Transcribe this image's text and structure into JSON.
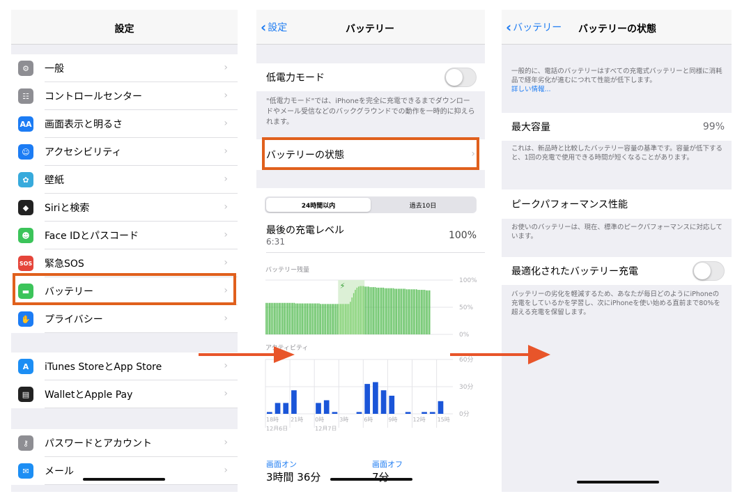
{
  "settings": {
    "title": "設定",
    "group1": [
      {
        "label": "一般",
        "icon": "gear-icon",
        "color": "#8e8e93"
      },
      {
        "label": "コントロールセンター",
        "icon": "toggles-icon",
        "color": "#8e8e93"
      },
      {
        "label": "画面表示と明るさ",
        "icon": "text-size-icon",
        "color": "#1c7cf4",
        "glyph": "AA"
      },
      {
        "label": "アクセシビリティ",
        "icon": "accessibility-icon",
        "color": "#1c7cf4"
      },
      {
        "label": "壁紙",
        "icon": "flower-icon",
        "color": "#37aadc"
      },
      {
        "label": "Siriと検索",
        "icon": "siri-icon",
        "color": "#222222"
      },
      {
        "label": "Face IDとパスコード",
        "icon": "face-id-icon",
        "color": "#3cc45a"
      },
      {
        "label": "緊急SOS",
        "icon": "sos-icon",
        "color": "#e5453a",
        "glyph": "SOS"
      },
      {
        "label": "バッテリー",
        "icon": "battery-icon",
        "color": "#3cc45a"
      },
      {
        "label": "プライバシー",
        "icon": "hand-icon",
        "color": "#1c7cf4"
      }
    ],
    "group2": [
      {
        "label": "iTunes StoreとApp Store",
        "icon": "app-store-icon",
        "color": "#1c8ef4"
      },
      {
        "label": "WalletとApple Pay",
        "icon": "wallet-icon",
        "color": "#222222"
      }
    ],
    "group3": [
      {
        "label": "パスワードとアカウント",
        "icon": "key-icon",
        "color": "#8e8e93"
      },
      {
        "label": "メール",
        "icon": "mail-icon",
        "color": "#1c8ef4"
      }
    ]
  },
  "battery": {
    "back_label": "設定",
    "title": "バッテリー",
    "low_power_label": "低電力モード",
    "low_power_desc": "\"低電力モード\"では、iPhoneを完全に充電できるまでダウンロードやメール受信などのバックグラウンドでの動作を一時的に抑えられます。",
    "health_row_label": "バッテリーの状態",
    "tab_24h": "24時間以内",
    "tab_10d": "過去10日",
    "last_charge_label": "最後の充電レベル",
    "last_charge_time": "6:31",
    "last_charge_value": "100%",
    "level_chart_title": "バッテリー残量",
    "activity_chart_title": "アクティビティ",
    "screen_on_label": "画面オン",
    "screen_on_value": "3時間 36分",
    "screen_off_label": "画面オフ",
    "screen_off_value": "7分"
  },
  "health": {
    "back_label": "バッテリー",
    "title": "バッテリーの状態",
    "intro": "一般的に、電話のバッテリーはすべての充電式バッテリーと同様に消耗品で経年劣化が進むにつれて性能が低下します。",
    "learn_more": "詳しい情報...",
    "max_capacity_label": "最大容量",
    "max_capacity_value": "99%",
    "capacity_desc": "これは、新品時と比較したバッテリー容量の基準です。容量が低下すると、1回の充電で使用できる時間が短くなることがあります。",
    "peak_label": "ピークパフォーマンス性能",
    "peak_desc": "お使いのバッテリーは、現在、標準のピークパフォーマンスに対応しています。",
    "optimized_label": "最適化されたバッテリー充電",
    "optimized_desc": "バッテリーの劣化を軽減するため、あなたが毎日どのようにiPhoneの充電をしているかを学習し、次にiPhoneを使い始める直前まで80%を超える充電を保留します。"
  },
  "chart_data": [
    {
      "type": "bar",
      "title": "バッテリー残量",
      "ytick_labels": [
        "100%",
        "50%",
        "0%"
      ],
      "ylim": [
        0,
        100
      ],
      "values": [
        58,
        58,
        58,
        58,
        58,
        58,
        58,
        58,
        58,
        58,
        58,
        58,
        58,
        58,
        58,
        58,
        58,
        58,
        57,
        57,
        57,
        57,
        57,
        57,
        57,
        57,
        57,
        57,
        57,
        57,
        57,
        57,
        57,
        56,
        56,
        56,
        56,
        56,
        56,
        56,
        56,
        56,
        56,
        56,
        56,
        56,
        56,
        56,
        56,
        56,
        56,
        60,
        68,
        76,
        82,
        86,
        88,
        89,
        89,
        89,
        88,
        88,
        88,
        87,
        87,
        87,
        87,
        86,
        86,
        86,
        86,
        86,
        85,
        85,
        85,
        85,
        85,
        85,
        84,
        84,
        84,
        84,
        84,
        84,
        84,
        83,
        83,
        83,
        83,
        83,
        83,
        83,
        82,
        82,
        82,
        82,
        82,
        81,
        81,
        81
      ],
      "charging_range": [
        44,
        60
      ]
    },
    {
      "type": "bar",
      "title": "アクティビティ",
      "ytick_labels": [
        "60分",
        "30分",
        "0分"
      ],
      "ylim": [
        0,
        60
      ],
      "categories": [
        "18時",
        "",
        "",
        "21時",
        "",
        "",
        "0時",
        "",
        "",
        "3時",
        "",
        "",
        "6時",
        "",
        "",
        "9時",
        "",
        "",
        "12時",
        "",
        "",
        "15時",
        ""
      ],
      "date_labels": [
        "12月6日",
        "12月7日"
      ],
      "values": [
        2,
        12,
        12,
        26,
        0,
        0,
        12,
        15,
        2,
        0,
        0,
        2,
        33,
        35,
        26,
        20,
        0,
        2,
        0,
        2,
        2,
        14,
        0
      ]
    }
  ]
}
